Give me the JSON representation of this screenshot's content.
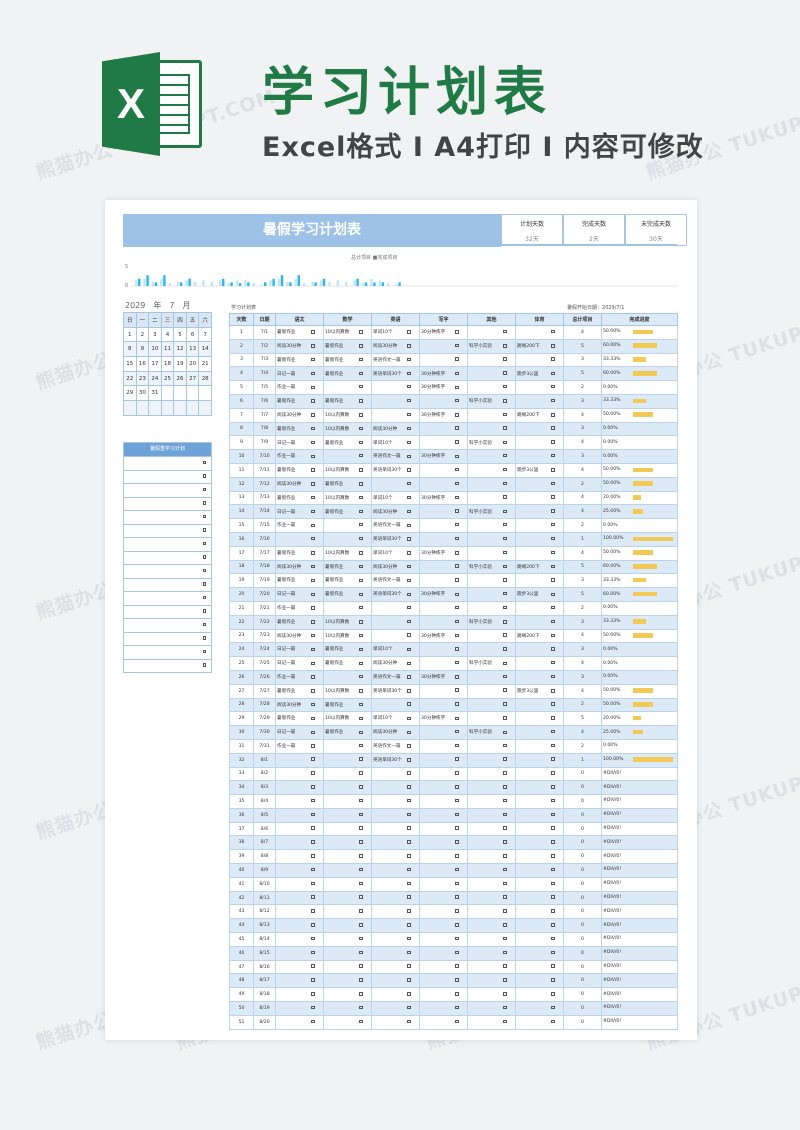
{
  "header": {
    "title": "学习计划表",
    "subtitle": "Excel格式 I A4打印 I 内容可修改",
    "logo_letter": "X"
  },
  "watermark": "熊猫办公 TUKUPPT.COM",
  "sheet": {
    "title": "暑假学习计划表",
    "stats": [
      {
        "label": "计划天数",
        "value": "32天"
      },
      {
        "label": "完成天数",
        "value": "2天"
      },
      {
        "label": "未完成天数",
        "value": "30天"
      }
    ],
    "chart_legend": [
      "总计项目",
      "完成项目"
    ],
    "chart_yticks": [
      "5",
      "0"
    ],
    "month_label": {
      "year": "2029",
      "y_unit": "年",
      "month": "7",
      "m_unit": "月"
    },
    "schedule_label": "学习计划表",
    "start_label": "暑假开始日期：",
    "start_date": "2029/7/1",
    "summer_plan_label": "暑假重学习计划",
    "calendar": {
      "weekdays": [
        "日",
        "一",
        "二",
        "三",
        "四",
        "五",
        "六"
      ],
      "weeks": [
        [
          "1",
          "2",
          "3",
          "4",
          "5",
          "6",
          "7"
        ],
        [
          "8",
          "9",
          "10",
          "11",
          "12",
          "13",
          "14"
        ],
        [
          "15",
          "16",
          "17",
          "18",
          "19",
          "20",
          "21"
        ],
        [
          "22",
          "23",
          "24",
          "25",
          "26",
          "27",
          "28"
        ],
        [
          "29",
          "30",
          "31",
          "",
          "",
          "",
          ""
        ],
        [
          "",
          "",
          "",
          "",
          "",
          "",
          ""
        ]
      ]
    },
    "plan_rows": 16,
    "columns": [
      "天数",
      "日期",
      "语文",
      "数学",
      "英语",
      "写字",
      "其他",
      "体育",
      "总计项目",
      "完成进度"
    ],
    "rows": [
      {
        "d": "1",
        "date": "7/1",
        "yw": "暑假作业",
        "sx": "10以内算数",
        "yy": "单词10个",
        "xz": "30分钟练字",
        "qt": "",
        "ty": "",
        "n": "4",
        "p": "50.00%",
        "f": 0.5
      },
      {
        "d": "2",
        "date": "7/2",
        "yw": "阅读30分钟",
        "sx": "暑假作业",
        "yy": "阅读30分钟",
        "xz": "",
        "qt": "科学小实验",
        "ty": "跳绳200下",
        "n": "5",
        "p": "60.00%",
        "f": 0.6
      },
      {
        "d": "3",
        "date": "7/3",
        "yw": "暑假作业",
        "sx": "暑假作业",
        "yy": "英语作文一篇",
        "xz": "",
        "qt": "",
        "ty": "",
        "n": "3",
        "p": "33.33%",
        "f": 0.3333
      },
      {
        "d": "4",
        "date": "7/4",
        "yw": "日记一篇",
        "sx": "暑假作业",
        "yy": "英语单词30个",
        "xz": "30分钟练字",
        "qt": "",
        "ty": "跑步3公里",
        "n": "5",
        "p": "60.00%",
        "f": 0.6
      },
      {
        "d": "5",
        "date": "7/5",
        "yw": "作业一篇",
        "sx": "",
        "yy": "",
        "xz": "30分钟练字",
        "qt": "",
        "ty": "",
        "n": "2",
        "p": "0.00%",
        "f": 0
      },
      {
        "d": "6",
        "date": "7/6",
        "yw": "暑假作业",
        "sx": "暑假作业",
        "yy": "",
        "xz": "",
        "qt": "科学小实验",
        "ty": "",
        "n": "3",
        "p": "33.33%",
        "f": 0.3333
      },
      {
        "d": "7",
        "date": "7/7",
        "yw": "阅读30分钟",
        "sx": "10以内算数",
        "yy": "",
        "xz": "30分钟练字",
        "qt": "",
        "ty": "跳绳200下",
        "n": "4",
        "p": "50.00%",
        "f": 0.5
      },
      {
        "d": "8",
        "date": "7/8",
        "yw": "暑假作业",
        "sx": "10以内算数",
        "yy": "阅读30分钟",
        "xz": "",
        "qt": "",
        "ty": "",
        "n": "3",
        "p": "0.00%",
        "f": 0
      },
      {
        "d": "9",
        "date": "7/9",
        "yw": "日记一篇",
        "sx": "暑假作业",
        "yy": "单词10个",
        "xz": "",
        "qt": "科学小实验",
        "ty": "",
        "n": "4",
        "p": "0.00%",
        "f": 0
      },
      {
        "d": "10",
        "date": "7/10",
        "yw": "作业一篇",
        "sx": "",
        "yy": "英语作文一篇",
        "xz": "30分钟练字",
        "qt": "",
        "ty": "",
        "n": "3",
        "p": "0.00%",
        "f": 0
      },
      {
        "d": "11",
        "date": "7/11",
        "yw": "暑假作业",
        "sx": "10以内算数",
        "yy": "英语单词30个",
        "xz": "",
        "qt": "",
        "ty": "跑步3公里",
        "n": "4",
        "p": "50.00%",
        "f": 0.5
      },
      {
        "d": "12",
        "date": "7/12",
        "yw": "阅读30分钟",
        "sx": "暑假作业",
        "yy": "",
        "xz": "",
        "qt": "",
        "ty": "",
        "n": "2",
        "p": "50.00%",
        "f": 0.5
      },
      {
        "d": "13",
        "date": "7/13",
        "yw": "暑假作业",
        "sx": "10以内算数",
        "yy": "单词10个",
        "xz": "30分钟练字",
        "qt": "",
        "ty": "",
        "n": "4",
        "p": "20.00%",
        "f": 0.2
      },
      {
        "d": "14",
        "date": "7/14",
        "yw": "日记一篇",
        "sx": "暑假作业",
        "yy": "阅读30分钟",
        "xz": "",
        "qt": "科学小实验",
        "ty": "",
        "n": "4",
        "p": "25.00%",
        "f": 0.25
      },
      {
        "d": "15",
        "date": "7/15",
        "yw": "作业一篇",
        "sx": "",
        "yy": "英语作文一篇",
        "xz": "",
        "qt": "",
        "ty": "",
        "n": "2",
        "p": "0.00%",
        "f": 0
      },
      {
        "d": "16",
        "date": "7/16",
        "yw": "",
        "sx": "",
        "yy": "英语单词30个",
        "xz": "",
        "qt": "",
        "ty": "",
        "n": "1",
        "p": "100.00%",
        "f": 1
      },
      {
        "d": "17",
        "date": "7/17",
        "yw": "暑假作业",
        "sx": "10以内算数",
        "yy": "单词10个",
        "xz": "30分钟练字",
        "qt": "",
        "ty": "",
        "n": "4",
        "p": "50.00%",
        "f": 0.5
      },
      {
        "d": "18",
        "date": "7/18",
        "yw": "阅读30分钟",
        "sx": "暑假作业",
        "yy": "阅读30分钟",
        "xz": "",
        "qt": "科学小实验",
        "ty": "跳绳200下",
        "n": "5",
        "p": "60.00%",
        "f": 0.6
      },
      {
        "d": "19",
        "date": "7/19",
        "yw": "暑假作业",
        "sx": "暑假作业",
        "yy": "英语作文一篇",
        "xz": "",
        "qt": "",
        "ty": "",
        "n": "3",
        "p": "33.33%",
        "f": 0.3333
      },
      {
        "d": "20",
        "date": "7/20",
        "yw": "日记一篇",
        "sx": "暑假作业",
        "yy": "英语单词30个",
        "xz": "30分钟练字",
        "qt": "",
        "ty": "跑步3公里",
        "n": "5",
        "p": "60.00%",
        "f": 0.6
      },
      {
        "d": "21",
        "date": "7/21",
        "yw": "作业一篇",
        "sx": "",
        "yy": "",
        "xz": "",
        "qt": "",
        "ty": "",
        "n": "2",
        "p": "0.00%",
        "f": 0
      },
      {
        "d": "22",
        "date": "7/22",
        "yw": "暑假作业",
        "sx": "10以内算数",
        "yy": "",
        "xz": "",
        "qt": "科学小实验",
        "ty": "",
        "n": "3",
        "p": "33.33%",
        "f": 0.3333
      },
      {
        "d": "23",
        "date": "7/23",
        "yw": "阅读30分钟",
        "sx": "10以内算数",
        "yy": "",
        "xz": "30分钟练字",
        "qt": "",
        "ty": "跳绳200下",
        "n": "4",
        "p": "50.00%",
        "f": 0.5
      },
      {
        "d": "24",
        "date": "7/24",
        "yw": "日记一篇",
        "sx": "暑假作业",
        "yy": "单词10个",
        "xz": "",
        "qt": "",
        "ty": "",
        "n": "3",
        "p": "0.00%",
        "f": 0
      },
      {
        "d": "25",
        "date": "7/25",
        "yw": "日记一篇",
        "sx": "暑假作业",
        "yy": "阅读30分钟",
        "xz": "",
        "qt": "科学小实验",
        "ty": "",
        "n": "4",
        "p": "0.00%",
        "f": 0
      },
      {
        "d": "26",
        "date": "7/26",
        "yw": "作业一篇",
        "sx": "",
        "yy": "英语作文一篇",
        "xz": "30分钟练字",
        "qt": "",
        "ty": "",
        "n": "3",
        "p": "0.00%",
        "f": 0
      },
      {
        "d": "27",
        "date": "7/27",
        "yw": "暑假作业",
        "sx": "10以内算数",
        "yy": "英语单词30个",
        "xz": "",
        "qt": "",
        "ty": "跑步3公里",
        "n": "4",
        "p": "50.00%",
        "f": 0.5
      },
      {
        "d": "28",
        "date": "7/28",
        "yw": "阅读30分钟",
        "sx": "暑假作业",
        "yy": "",
        "xz": "",
        "qt": "",
        "ty": "",
        "n": "2",
        "p": "50.00%",
        "f": 0.5
      },
      {
        "d": "29",
        "date": "7/29",
        "yw": "暑假作业",
        "sx": "10以内算数",
        "yy": "单词10个",
        "xz": "30分钟练字",
        "qt": "",
        "ty": "",
        "n": "5",
        "p": "20.00%",
        "f": 0.2
      },
      {
        "d": "30",
        "date": "7/30",
        "yw": "日记一篇",
        "sx": "暑假作业",
        "yy": "阅读30分钟",
        "xz": "",
        "qt": "科学小实验",
        "ty": "",
        "n": "4",
        "p": "25.00%",
        "f": 0.25
      },
      {
        "d": "31",
        "date": "7/31",
        "yw": "作业一篇",
        "sx": "",
        "yy": "英语作文一篇",
        "xz": "",
        "qt": "",
        "ty": "",
        "n": "2",
        "p": "0.00%",
        "f": 0
      },
      {
        "d": "32",
        "date": "8/1",
        "yw": "",
        "sx": "",
        "yy": "英语单词30个",
        "xz": "",
        "qt": "",
        "ty": "",
        "n": "1",
        "p": "100.00%",
        "f": 1
      },
      {
        "d": "33",
        "date": "8/2",
        "yw": "",
        "sx": "",
        "yy": "",
        "xz": "",
        "qt": "",
        "ty": "",
        "n": "0",
        "p": "#DIV/0!",
        "f": 0
      },
      {
        "d": "34",
        "date": "8/3",
        "yw": "",
        "sx": "",
        "yy": "",
        "xz": "",
        "qt": "",
        "ty": "",
        "n": "0",
        "p": "#DIV/0!",
        "f": 0
      },
      {
        "d": "35",
        "date": "8/4",
        "yw": "",
        "sx": "",
        "yy": "",
        "xz": "",
        "qt": "",
        "ty": "",
        "n": "0",
        "p": "#DIV/0!",
        "f": 0
      },
      {
        "d": "36",
        "date": "8/5",
        "yw": "",
        "sx": "",
        "yy": "",
        "xz": "",
        "qt": "",
        "ty": "",
        "n": "0",
        "p": "#DIV/0!",
        "f": 0
      },
      {
        "d": "37",
        "date": "8/6",
        "yw": "",
        "sx": "",
        "yy": "",
        "xz": "",
        "qt": "",
        "ty": "",
        "n": "0",
        "p": "#DIV/0!",
        "f": 0
      },
      {
        "d": "38",
        "date": "8/7",
        "yw": "",
        "sx": "",
        "yy": "",
        "xz": "",
        "qt": "",
        "ty": "",
        "n": "0",
        "p": "#DIV/0!",
        "f": 0
      },
      {
        "d": "39",
        "date": "8/8",
        "yw": "",
        "sx": "",
        "yy": "",
        "xz": "",
        "qt": "",
        "ty": "",
        "n": "0",
        "p": "#DIV/0!",
        "f": 0
      },
      {
        "d": "40",
        "date": "8/9",
        "yw": "",
        "sx": "",
        "yy": "",
        "xz": "",
        "qt": "",
        "ty": "",
        "n": "0",
        "p": "#DIV/0!",
        "f": 0
      },
      {
        "d": "41",
        "date": "8/10",
        "yw": "",
        "sx": "",
        "yy": "",
        "xz": "",
        "qt": "",
        "ty": "",
        "n": "0",
        "p": "#DIV/0!",
        "f": 0
      },
      {
        "d": "42",
        "date": "8/11",
        "yw": "",
        "sx": "",
        "yy": "",
        "xz": "",
        "qt": "",
        "ty": "",
        "n": "0",
        "p": "#DIV/0!",
        "f": 0
      },
      {
        "d": "43",
        "date": "8/12",
        "yw": "",
        "sx": "",
        "yy": "",
        "xz": "",
        "qt": "",
        "ty": "",
        "n": "0",
        "p": "#DIV/0!",
        "f": 0
      },
      {
        "d": "44",
        "date": "8/13",
        "yw": "",
        "sx": "",
        "yy": "",
        "xz": "",
        "qt": "",
        "ty": "",
        "n": "0",
        "p": "#DIV/0!",
        "f": 0
      },
      {
        "d": "45",
        "date": "8/14",
        "yw": "",
        "sx": "",
        "yy": "",
        "xz": "",
        "qt": "",
        "ty": "",
        "n": "0",
        "p": "#DIV/0!",
        "f": 0
      },
      {
        "d": "46",
        "date": "8/15",
        "yw": "",
        "sx": "",
        "yy": "",
        "xz": "",
        "qt": "",
        "ty": "",
        "n": "0",
        "p": "#DIV/0!",
        "f": 0
      },
      {
        "d": "47",
        "date": "8/16",
        "yw": "",
        "sx": "",
        "yy": "",
        "xz": "",
        "qt": "",
        "ty": "",
        "n": "0",
        "p": "#DIV/0!",
        "f": 0
      },
      {
        "d": "48",
        "date": "8/17",
        "yw": "",
        "sx": "",
        "yy": "",
        "xz": "",
        "qt": "",
        "ty": "",
        "n": "0",
        "p": "#DIV/0!",
        "f": 0
      },
      {
        "d": "49",
        "date": "8/18",
        "yw": "",
        "sx": "",
        "yy": "",
        "xz": "",
        "qt": "",
        "ty": "",
        "n": "0",
        "p": "#DIV/0!",
        "f": 0
      },
      {
        "d": "50",
        "date": "8/19",
        "yw": "",
        "sx": "",
        "yy": "",
        "xz": "",
        "qt": "",
        "ty": "",
        "n": "0",
        "p": "#DIV/0!",
        "f": 0
      },
      {
        "d": "51",
        "date": "8/20",
        "yw": "",
        "sx": "",
        "yy": "",
        "xz": "",
        "qt": "",
        "ty": "",
        "n": "0",
        "p": "#DIV/0!",
        "f": 0
      }
    ]
  },
  "colors": {
    "brand_green": "#1f7a45",
    "header_blue": "#9dc1e7",
    "row_blue": "#dce9f6",
    "progress": "#f2c955",
    "chart_bar": "#29b6f0"
  }
}
